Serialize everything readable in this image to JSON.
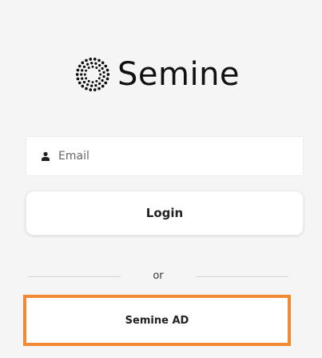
{
  "brand": {
    "name": "Semine",
    "logo_icon": "dotted-circle-logo-icon"
  },
  "email": {
    "icon": "user-icon",
    "placeholder": "Email",
    "value": ""
  },
  "login_button": {
    "label": "Login"
  },
  "divider": {
    "label": "or"
  },
  "sso_button": {
    "label": "Semine AD",
    "highlight_color": "#f28a35"
  }
}
